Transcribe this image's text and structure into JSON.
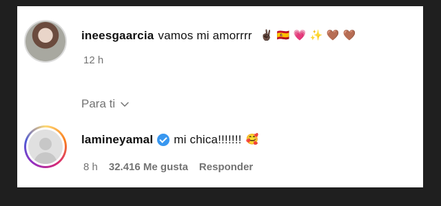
{
  "comments": [
    {
      "username": "ineesgaarcia",
      "text": "vamos mi amorrrr",
      "emojis": [
        "✌🏿",
        "🇪🇸",
        "💗",
        "✨",
        "🤎",
        "🤎"
      ],
      "time": "12 h"
    },
    {
      "username": "lamineyamal",
      "verified": true,
      "text": "mi chica!!!!!!!",
      "emoji": "🥰",
      "time": "8 h",
      "likes": "32.416 Me gusta",
      "reply": "Responder"
    }
  ],
  "section": {
    "label": "Para ti",
    "chevron": "chevron-down-icon"
  },
  "colors": {
    "verified": "#3897f0",
    "meta_text": "#737373",
    "background": "#1f1f1f"
  }
}
